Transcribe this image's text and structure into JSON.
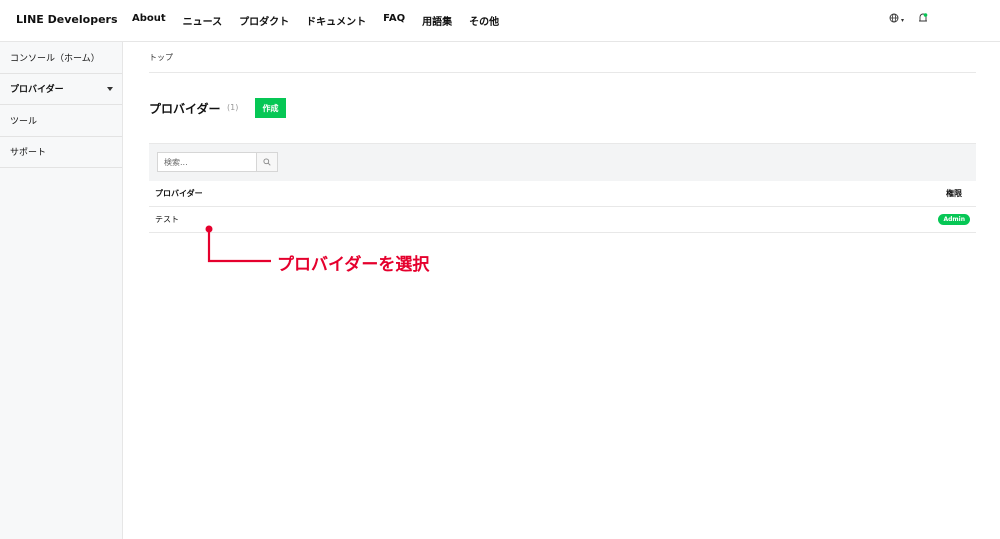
{
  "header": {
    "logo": "LINE Developers",
    "nav": [
      "About",
      "ニュース",
      "プロダクト",
      "ドキュメント",
      "FAQ",
      "用語集",
      "その他"
    ],
    "globe_caret": "▾"
  },
  "sidebar": {
    "items": [
      {
        "label": "コンソール（ホーム）"
      },
      {
        "label": "プロバイダー"
      },
      {
        "label": "ツール"
      },
      {
        "label": "サポート"
      }
    ]
  },
  "main": {
    "breadcrumb": "トップ",
    "title": "プロバイダー",
    "count": "(1)",
    "create_label": "作成",
    "search_placeholder": "検索...",
    "table": {
      "headers": [
        "プロバイダー",
        "権限"
      ],
      "rows": [
        {
          "name": "テスト",
          "role": "Admin"
        }
      ]
    }
  },
  "annotation": {
    "text": "プロバイダーを選択",
    "color": "#e5002d"
  },
  "colors": {
    "brand_green": "#06c755"
  }
}
